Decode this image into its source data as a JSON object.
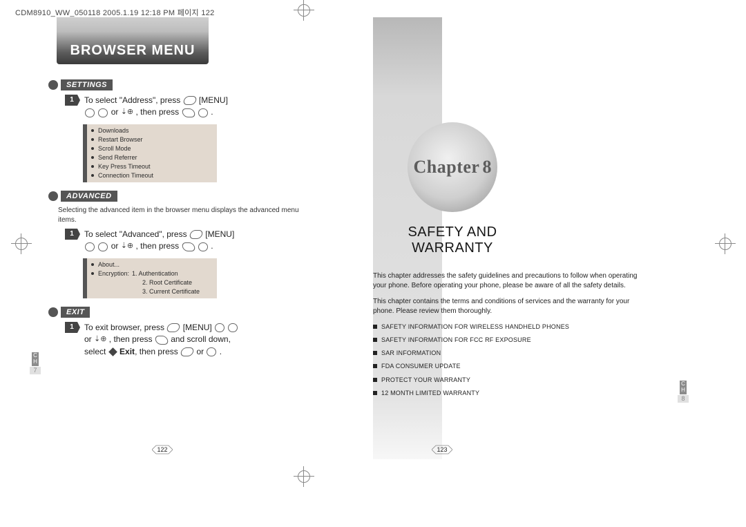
{
  "header_line": "CDM8910_WW_050118  2005.1.19  12:18 PM  페이지 122",
  "left_page": {
    "banner_title": "BROWSER MENU",
    "settings": {
      "label": "SETTINGS",
      "step_number": "1",
      "step_text_a": "To select \"Address\", press ",
      "step_text_menu": "[MENU]",
      "step_text_b": "or",
      "step_text_c": ", then press",
      "menu_items": [
        "Downloads",
        "Restart Browser",
        "Scroll Mode",
        "Send Referrer",
        "Key Press Timeout",
        "Connection Timeout"
      ]
    },
    "advanced": {
      "label": "ADVANCED",
      "note": "Selecting the advanced item in the browser menu displays the advanced menu items.",
      "step_number": "1",
      "step_text_a": "To select \"Advanced\", press ",
      "step_text_menu": "[MENU]",
      "step_text_b": "or",
      "step_text_c": ", then press",
      "menu_items": [
        {
          "label": "About..."
        },
        {
          "label": "Encryption:",
          "subs": [
            "1. Authentication",
            "2. Root Certificate",
            "3. Current Certificate"
          ]
        }
      ]
    },
    "exit": {
      "label": "EXIT",
      "step_number": "1",
      "line1_a": "To exit browser, press ",
      "line1_menu": "[MENU]",
      "line2_a": "or",
      "line2_b": ", then press",
      "line2_c": "and scroll down,",
      "line3_a": "select",
      "line3_b": "Exit",
      "line3_c": ", then press",
      "line3_d": "or"
    },
    "ch_tab": {
      "label": "C\nH",
      "number": "7"
    },
    "page_number": "122"
  },
  "right_page": {
    "chapter_word": "Chapter",
    "chapter_number": "8",
    "chapter_title_line1": "SAFETY AND",
    "chapter_title_line2": "WARRANTY",
    "para1": "This chapter addresses the safety guidelines and precautions to follow when operating your phone. Before operating your phone, please be aware of all the safety details.",
    "para2": "This chapter contains the terms and conditions of services and the warranty for your phone. Please review them thoroughly.",
    "toc": [
      "SAFETY INFORMATION FOR WIRELESS HANDHELD PHONES",
      "SAFETY INFORMATION FOR FCC RF EXPOSURE",
      "SAR INFORMATION",
      "FDA CONSUMER UPDATE",
      "PROTECT YOUR WARRANTY",
      "12 MONTH LIMITED WARRANTY"
    ],
    "ch_tab": {
      "label": "C\nH",
      "number": "8"
    },
    "page_number": "123"
  }
}
